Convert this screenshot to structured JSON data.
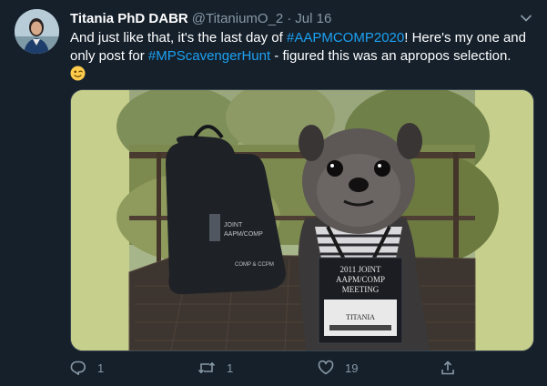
{
  "tweet": {
    "display_name": "Titania PhD DABR",
    "handle": "@TitaniumO_2",
    "separator": "·",
    "date": "Jul 16",
    "text": {
      "part1": "And just like that, it's the last day of ",
      "hashtag1": "#AAPMCOMP2020",
      "part2": "! Here's my one and only post for ",
      "hashtag2": "#MPScavengerHunt",
      "part3": " - figured this was an apropos selection."
    },
    "emoji": "winking-face-emoji"
  },
  "media": {
    "bag_text": [
      "JOINT",
      "AAPM/COMP",
      "COMP & CCPM"
    ],
    "badge_text": {
      "line1": "2011 JOINT",
      "line2": "AAPM/COMP",
      "line3": "MEETING",
      "name": "TITANIA"
    }
  },
  "actions": {
    "reply_count": "1",
    "retweet_count": "1",
    "like_count": "19"
  },
  "colors": {
    "background": "#15202b",
    "text": "#ffffff",
    "secondary_text": "#8899a6",
    "hashtag": "#1da1f2",
    "media_pad": "#c6cf8c"
  }
}
